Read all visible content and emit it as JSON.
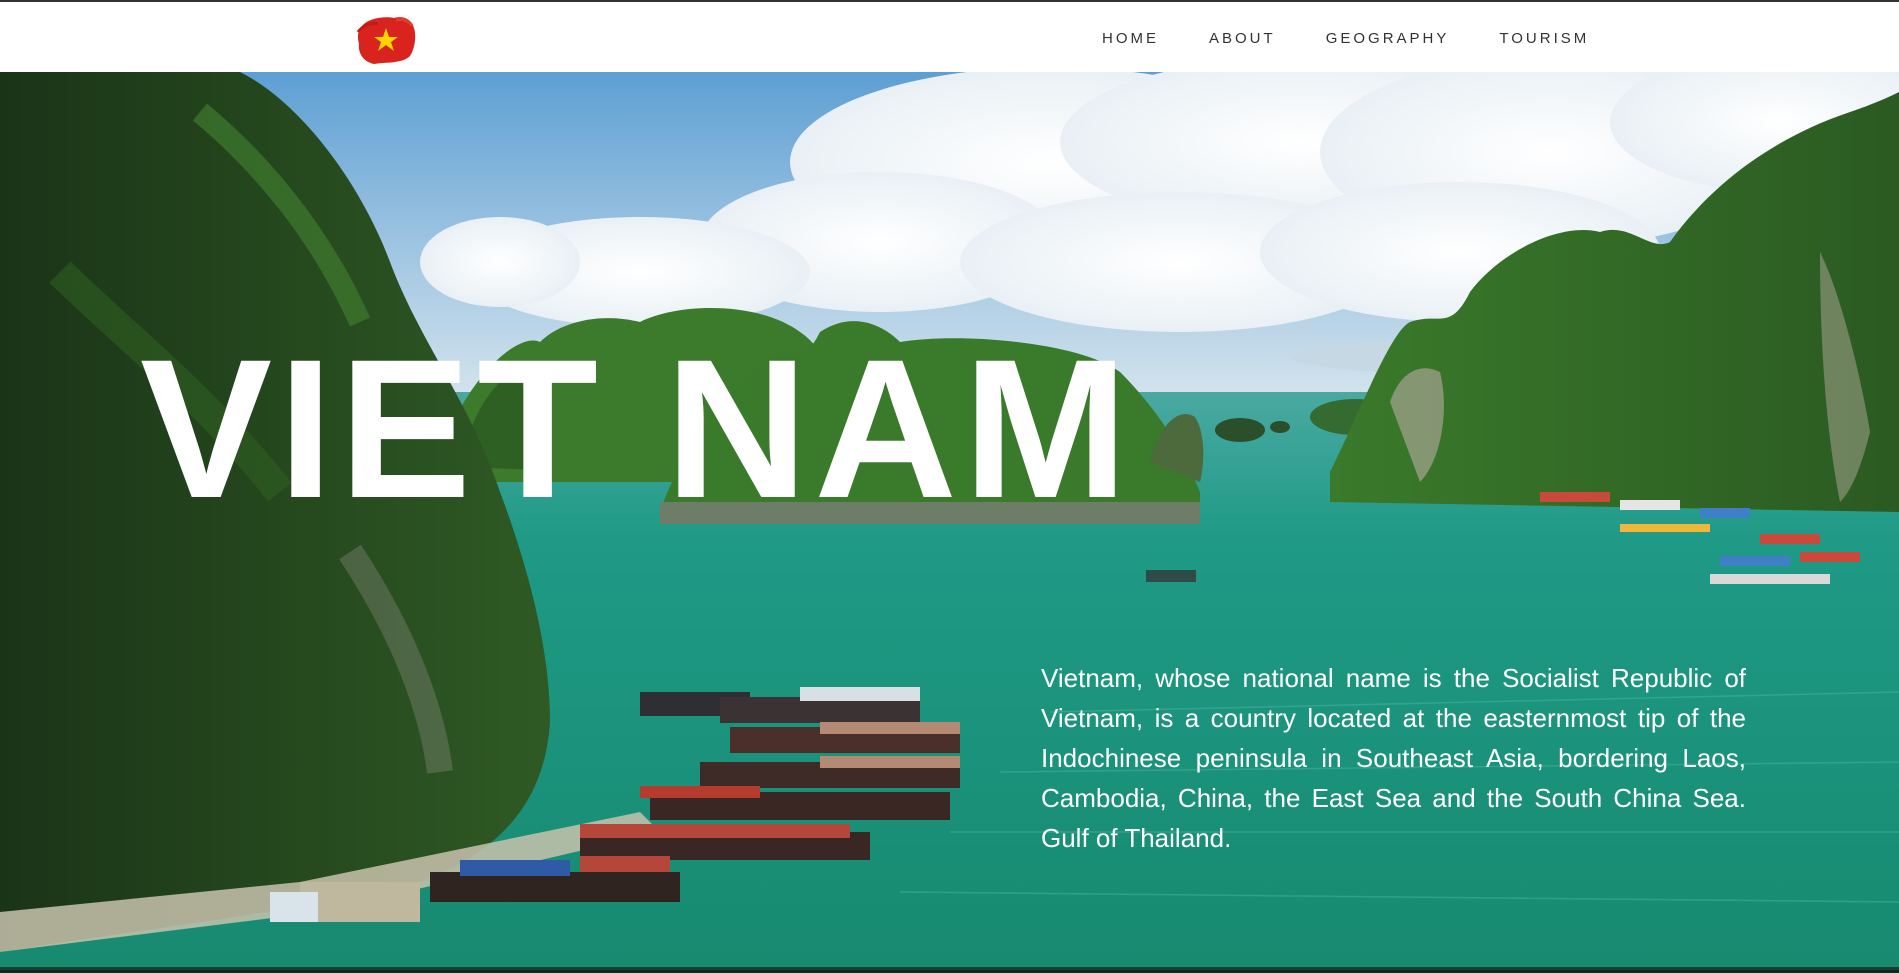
{
  "brand": {
    "logo_icon": "vietnam-flag-icon",
    "colors": {
      "flag_red": "#d8231f",
      "flag_star": "#ffd400"
    }
  },
  "nav": {
    "items": [
      {
        "label": "HOME"
      },
      {
        "label": "ABOUT"
      },
      {
        "label": "GEOGRAPHY"
      },
      {
        "label": "TOURISM"
      }
    ]
  },
  "hero": {
    "title": "VIET NAM",
    "description": "Vietnam, whose national name is the Socialist Republic of Vietnam, is a country located at the easternmost tip of the Indochinese peninsula in Southeast Asia, bordering Laos, Cambodia, China, the East Sea and the South China Sea. Gulf of Thailand.",
    "background": "ha-long-bay-photo",
    "colors": {
      "sky": "#7fb4dc",
      "water": "#1f9a86",
      "cliff": "#24451f"
    }
  }
}
